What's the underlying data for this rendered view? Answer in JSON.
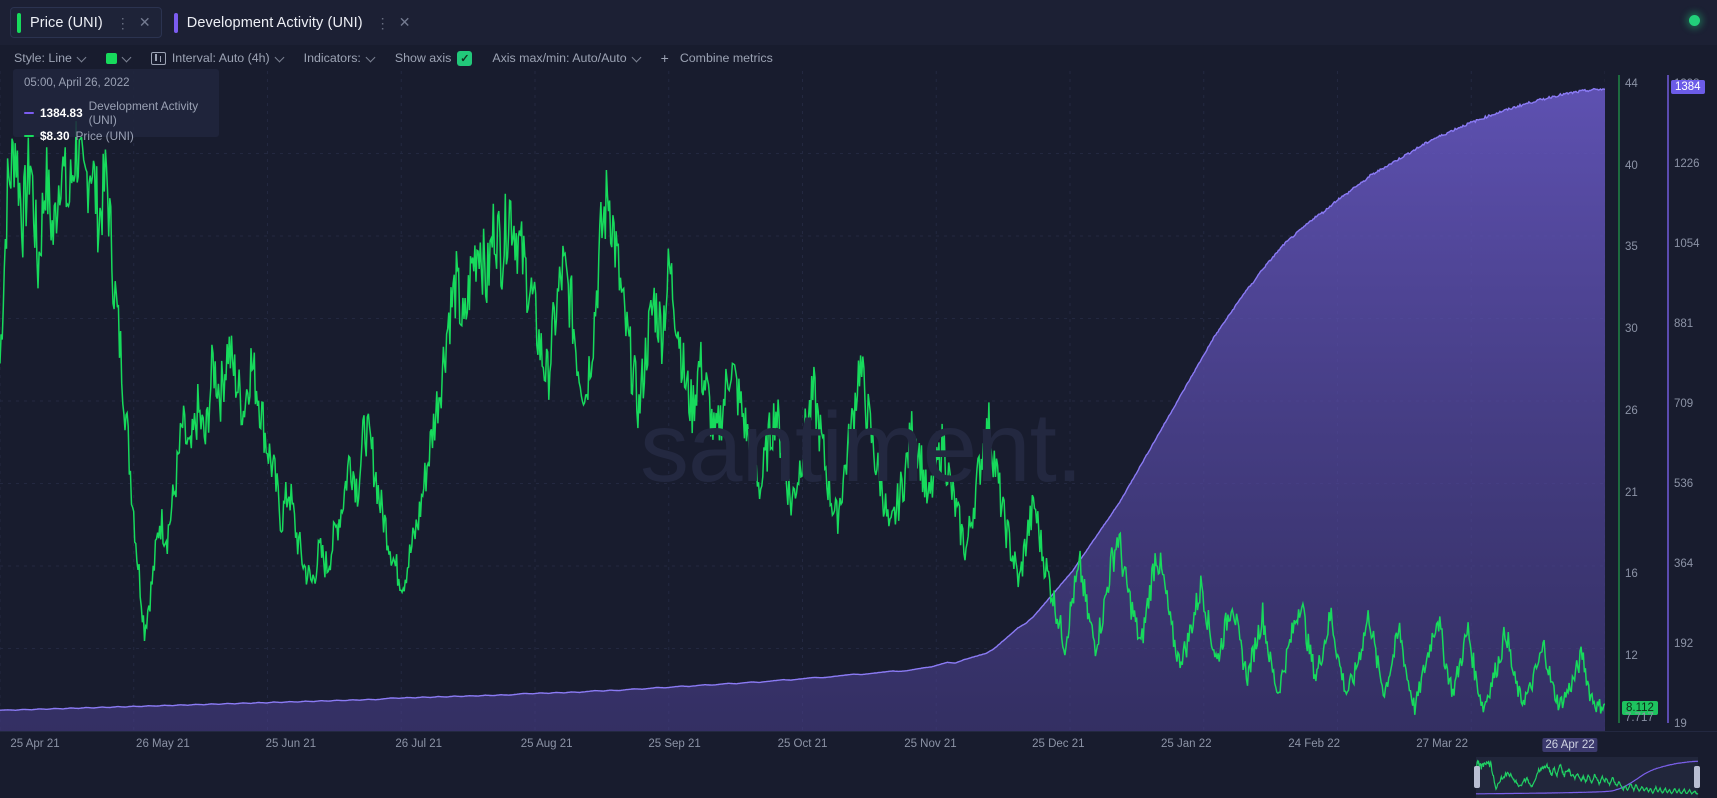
{
  "tabs": [
    {
      "label": "Price (UNI)",
      "color": "#17da5c",
      "active": true,
      "menu_icon": "kebab-menu-icon",
      "close_icon": "close-icon"
    },
    {
      "label": "Development Activity (UNI)",
      "color": "#7b5cf0",
      "active": false,
      "menu_icon": "kebab-menu-icon",
      "close_icon": "close-icon"
    }
  ],
  "status": {
    "indicator_color": "#22d07a"
  },
  "toolbar": {
    "style": "Style: Line",
    "color_swatch": "#17da5c",
    "interval": "Interval: Auto (4h)",
    "indicators": "Indicators:",
    "show_axis": "Show axis",
    "show_axis_checked": true,
    "axis_maxmin": "Axis max/min: Auto/Auto",
    "combine_metrics": "Combine metrics",
    "plus": "+",
    "check_glyph": "✓"
  },
  "tooltip": {
    "date": "05:00, April 26, 2022",
    "rows": [
      {
        "value": "1384.83",
        "name": "Development Activity (UNI)",
        "color": "#7b5cf0"
      },
      {
        "value": "$8.30",
        "name": "Price (UNI)",
        "color": "#17da5c"
      }
    ]
  },
  "watermark": "santiment.",
  "chart_data": {
    "type": "line",
    "title": "",
    "xlabel": "",
    "ylabel": "",
    "grid": true,
    "legend": "tooltip-top-left",
    "x_tick_labels": [
      "25 Apr 21",
      "26 May 21",
      "25 Jun 21",
      "26 Jul 21",
      "25 Aug 21",
      "25 Sep 21",
      "25 Oct 21",
      "25 Nov 21",
      "25 Dec 21",
      "25 Jan 22",
      "24 Feb 22",
      "27 Mar 22",
      "26 Apr 22"
    ],
    "x_tick_highlighted": "26 Apr 22",
    "axes": [
      {
        "name": "Price (UNI)",
        "color": "#17da5c",
        "side": "right-inner",
        "tick_labels": [
          "44",
          "40",
          "35",
          "30",
          "26",
          "21",
          "16",
          "12"
        ],
        "current_value_badge": "8.112",
        "value_under_badge": "7.717",
        "range": [
          7.717,
          44
        ]
      },
      {
        "name": "Development Activity (UNI)",
        "color": "#6c5ce8",
        "side": "right-outer",
        "tick_labels": [
          "1398",
          "1226",
          "1054",
          "881",
          "709",
          "536",
          "364",
          "192",
          "19"
        ],
        "current_value_badge": "1384",
        "range": [
          19,
          1398
        ]
      }
    ],
    "series": [
      {
        "name": "Price (UNI)",
        "color": "#17da5c",
        "axis": "Price (UNI)",
        "style": "line",
        "values": [
          30,
          41,
          44,
          39,
          43,
          36,
          42,
          38,
          43,
          40,
          44,
          41,
          43,
          39,
          42,
          35,
          30,
          24,
          18,
          13,
          16,
          20,
          19,
          22,
          26,
          24,
          27,
          25,
          30,
          28,
          31,
          29,
          27,
          30,
          28,
          25,
          23,
          20,
          22,
          19,
          17,
          16,
          18,
          17,
          19,
          21,
          24,
          22,
          26,
          24,
          21,
          19,
          17,
          16,
          18,
          20,
          23,
          26,
          29,
          33,
          35,
          32,
          36,
          38,
          35,
          39,
          37,
          40,
          38,
          36,
          34,
          31,
          29,
          33,
          36,
          34,
          30,
          28,
          32,
          38,
          41,
          37,
          33,
          30,
          27,
          31,
          34,
          32,
          36,
          33,
          29,
          27,
          30,
          28,
          25,
          27,
          30,
          28,
          26,
          24,
          22,
          25,
          27,
          24,
          21,
          23,
          26,
          28,
          25,
          22,
          20,
          23,
          26,
          30,
          27,
          24,
          22,
          19,
          21,
          23,
          26,
          24,
          21,
          23,
          25,
          22,
          20,
          18,
          21,
          24,
          26,
          23,
          20,
          18,
          16,
          19,
          21,
          18,
          16,
          14,
          12,
          15,
          17,
          14,
          12,
          14,
          17,
          19,
          16,
          14,
          12,
          15,
          18,
          16,
          13,
          11,
          12,
          14,
          16,
          13,
          11,
          13,
          15,
          12,
          10,
          12,
          14,
          11,
          9,
          11,
          13,
          15,
          12,
          10,
          12,
          14,
          11,
          9,
          10,
          12,
          14,
          11,
          9,
          11,
          13,
          10,
          8,
          10,
          12,
          14,
          11,
          9,
          11,
          13,
          10,
          8,
          9.5,
          11,
          13,
          10,
          8.5,
          9,
          10.5,
          12,
          9.5,
          8.2,
          9,
          10,
          11.5,
          9,
          8.1,
          8.3
        ]
      },
      {
        "name": "Development Activity (UNI)",
        "color": "#7b5cf0",
        "axis": "Development Activity (UNI)",
        "style": "area",
        "values": [
          25,
          26,
          25,
          27,
          26,
          28,
          27,
          29,
          28,
          30,
          29,
          31,
          30,
          32,
          31,
          33,
          32,
          34,
          33,
          35,
          34,
          36,
          35,
          37,
          36,
          38,
          37,
          39,
          38,
          40,
          39,
          41,
          40,
          42,
          41,
          43,
          42,
          44,
          43,
          45,
          44,
          46,
          45,
          47,
          46,
          48,
          47,
          49,
          48,
          50,
          52,
          51,
          53,
          52,
          54,
          53,
          55,
          54,
          56,
          55,
          57,
          56,
          58,
          57,
          59,
          58,
          60,
          62,
          61,
          63,
          62,
          64,
          63,
          65,
          64,
          66,
          68,
          67,
          69,
          68,
          70,
          72,
          71,
          73,
          75,
          74,
          76,
          78,
          77,
          79,
          81,
          80,
          82,
          84,
          83,
          85,
          87,
          86,
          88,
          90,
          92,
          91,
          93,
          95,
          97,
          96,
          98,
          100,
          102,
          104,
          103,
          105,
          107,
          109,
          111,
          110,
          112,
          115,
          118,
          120,
          125,
          130,
          128,
          135,
          140,
          145,
          150,
          160,
          175,
          190,
          205,
          215,
          230,
          250,
          270,
          290,
          310,
          330,
          355,
          380,
          405,
          430,
          455,
          480,
          510,
          540,
          570,
          600,
          630,
          660,
          690,
          720,
          750,
          780,
          810,
          840,
          865,
          890,
          915,
          940,
          960,
          985,
          1005,
          1025,
          1045,
          1060,
          1075,
          1090,
          1105,
          1115,
          1130,
          1145,
          1155,
          1170,
          1180,
          1195,
          1205,
          1215,
          1225,
          1235,
          1245,
          1255,
          1265,
          1275,
          1282,
          1290,
          1298,
          1305,
          1312,
          1318,
          1325,
          1331,
          1337,
          1342,
          1348,
          1353,
          1358,
          1362,
          1367,
          1371,
          1374,
          1377,
          1380,
          1382,
          1384,
          1384
        ]
      }
    ]
  },
  "minimap": {
    "selection_label": "range-selector",
    "left_handle": "left-handle",
    "right_handle": "right-handle"
  }
}
